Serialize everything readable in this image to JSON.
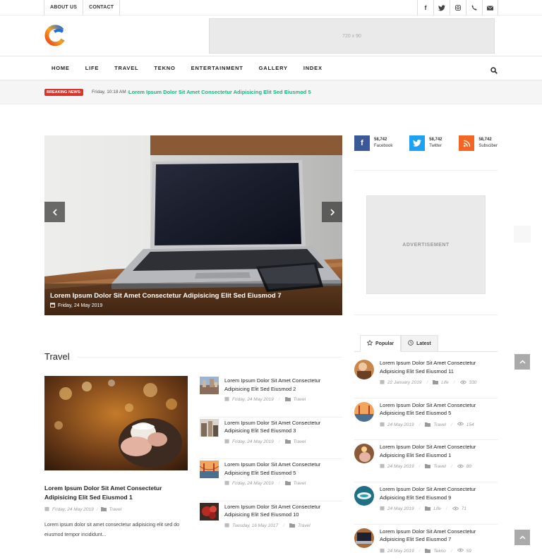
{
  "topbar": {
    "links": [
      "ABOUT US",
      "CONTACT"
    ]
  },
  "header": {
    "ad_label": "720 x 90"
  },
  "nav": {
    "items": [
      "HOME",
      "LIFE",
      "TRAVEL",
      "TEKNO",
      "ENTERTAINMENT",
      "GALLERY",
      "INDEX"
    ]
  },
  "breaking": {
    "badge": "BREAKING NEWS:",
    "date": "Friday, 10:18 AM -",
    "title": "Lorem Ipsum Dolor Sit Amet Consectetur Adipisicing Elit Sed Eiusmod 5"
  },
  "slider": {
    "title": "Lorem Ipsum Dolor Sit Amet Consectetur Adipisicing Elit Sed Eiusmod 7",
    "date": "Friday, 24 May 2019"
  },
  "counters": [
    {
      "count": "58,742",
      "label": "Facebook",
      "color": "#3b5998",
      "icon": "facebook-icon"
    },
    {
      "count": "58,742",
      "label": "Twitter",
      "color": "#1da1f2",
      "icon": "twitter-icon"
    },
    {
      "count": "58,742",
      "label": "Subsciber",
      "color": "#f26522",
      "icon": "rss-icon"
    }
  ],
  "sidebar": {
    "advert": "ADVERTISEMENT"
  },
  "travel": {
    "title": "Travel",
    "featured": {
      "title": "Lorem Ipsum Dolor Sit Amet Consectetur Adipisicing Elit Sed Eiusmod 1",
      "date": "Friday, 24 May 2019",
      "category": "Travel",
      "excerpt": "Lorem ipsum dolor sit amet consectetur adipisicing elit sed do eiusmod tempor incididunt..."
    },
    "list": [
      {
        "title": "Lorem Ipsum Dolor Sit Amet Consectetur Adipisicing Elit Sed Eiusmod 2",
        "date": "Friday, 24 May 2019",
        "category": "Travel"
      },
      {
        "title": "Lorem Ipsum Dolor Sit Amet Consectetur Adipisicing Elit Sed Eiusmod 3",
        "date": "Friday, 24 May 2019",
        "category": "Travel"
      },
      {
        "title": "Lorem Ipsum Dolor Sit Amet Consectetur Adipisicing Elit Sed Eiusmod 5",
        "date": "Friday, 24 May 2019",
        "category": "Travel"
      },
      {
        "title": "Lorem Ipsum Dolor Sit Amet Consectetur Adipisicing Elit Sed Eiusmod 10",
        "date": "Tuesday, 16 May 2017",
        "category": "Travel"
      }
    ]
  },
  "tabs": {
    "popular": "Popular",
    "latest": "Latest"
  },
  "popular": [
    {
      "title": "Lorem Ipsum Dolor Sit Amet Consectetur Adipisicing Elit Sed Eiusmod 11",
      "date": "22 January 2019",
      "category": "Life",
      "views": "330"
    },
    {
      "title": "Lorem Ipsum Dolor Sit Amet Consectetur Adipisicing Elit Sed Eiusmod 5",
      "date": "24 May 2019",
      "category": "Travel",
      "views": "154"
    },
    {
      "title": "Lorem Ipsum Dolor Sit Amet Consectetur Adipisicing Elit Sed Eiusmod 1",
      "date": "24 May 2019",
      "category": "Travel",
      "views": "80"
    },
    {
      "title": "Lorem Ipsum Dolor Sit Amet Consectetur Adipisicing Elit Sed Eiusmod 9",
      "date": "24 May 2019",
      "category": "Life",
      "views": "71"
    },
    {
      "title": "Lorem Ipsum Dolor Sit Amet Consectetur Adipisicing Elit Sed Eiusmod 7",
      "date": "24 May 2019",
      "category": "Tekno",
      "views": "59"
    }
  ]
}
